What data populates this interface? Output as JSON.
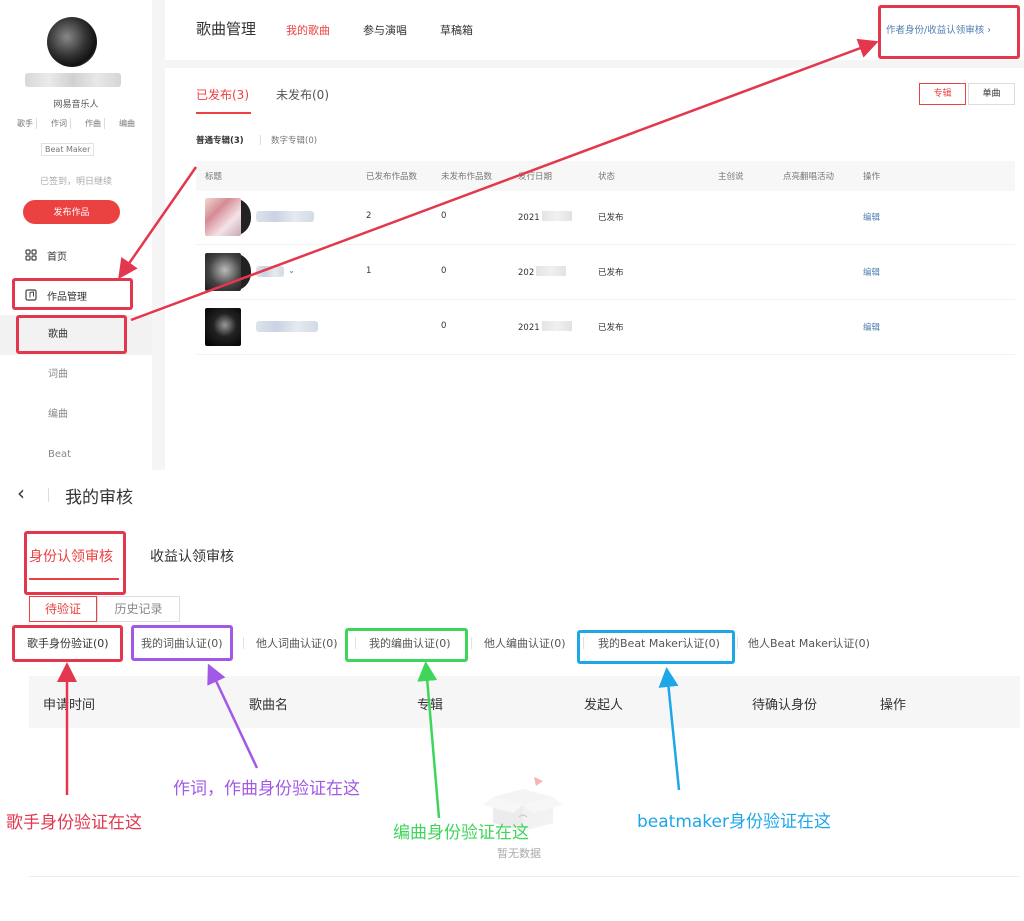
{
  "profile": {
    "role": "网易音乐人",
    "tags": [
      "歌手",
      "作词",
      "作曲",
      "编曲"
    ],
    "beat_maker": "Beat Maker",
    "sign_status": "已签到，明日继续",
    "publish_button": "发布作品"
  },
  "nav": {
    "home": "首页",
    "works": "作品管理",
    "sub_items": [
      "歌曲",
      "词曲",
      "编曲",
      "Beat"
    ]
  },
  "header": {
    "title": "歌曲管理",
    "tabs": [
      "我的歌曲",
      "参与演唱",
      "草稿箱"
    ],
    "review_link": "作者身份/收益认领审核",
    "review_chevron": "›"
  },
  "content": {
    "publish_tabs": [
      "已发布(3)",
      "未发布(0)"
    ],
    "view_toggle": [
      "专辑",
      "单曲"
    ],
    "album_tabs": [
      "普通专辑(3)",
      "数字专辑(0)"
    ],
    "columns": [
      "标题",
      "已发布作品数",
      "未发布作品数",
      "发行日期",
      "状态",
      "主创说",
      "点亮翻唱活动",
      "操作"
    ],
    "rows": [
      {
        "title_suffix": "",
        "published": "2",
        "unpublished": "0",
        "date": "2021",
        "status": "已发布",
        "action": "编辑"
      },
      {
        "title_suffix": "⌄",
        "published": "1",
        "unpublished": "0",
        "date": "202",
        "status": "已发布",
        "action": "编辑"
      },
      {
        "title_suffix": "",
        "published": "",
        "unpublished": "0",
        "date": "2021",
        "status": "已发布",
        "action": "编辑"
      }
    ]
  },
  "review": {
    "back": "‹",
    "title": "我的审核",
    "tabs": [
      "身份认领审核",
      "收益认领审核"
    ],
    "sub_tabs": [
      "待验证",
      "历史记录"
    ],
    "verify_tabs": [
      "歌手身份验证(0)",
      "我的词曲认证(0)",
      "他人词曲认证(0)",
      "我的编曲认证(0)",
      "他人编曲认证(0)",
      "我的Beat Maker认证(0)",
      "他人Beat Maker认证(0)"
    ],
    "columns": [
      "申请时间",
      "歌曲名",
      "专辑",
      "发起人",
      "待确认身份",
      "操作"
    ],
    "empty_text": "暂无数据"
  },
  "annotations": {
    "singer": "歌手身份验证在这",
    "lyric_composer": "作词，作曲身份验证在这",
    "arranger": "编曲身份验证在这",
    "beatmaker": "beatmaker身份验证在这"
  },
  "colors": {
    "brand_red": "#ec4141",
    "annotation_red": "#e3374d",
    "annotation_purple": "#a259e6",
    "annotation_green": "#3ed65a",
    "annotation_blue": "#1ea7e8",
    "link_blue": "#507daf"
  }
}
